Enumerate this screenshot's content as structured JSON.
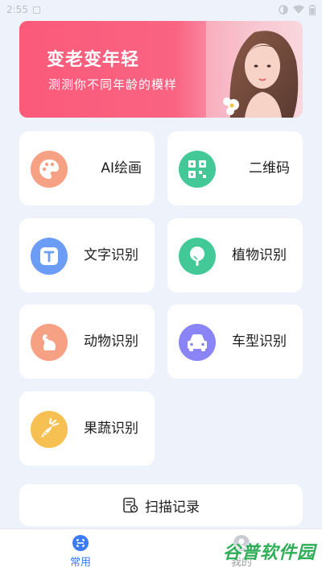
{
  "status_bar": {
    "time": "2:55"
  },
  "banner": {
    "title": "变老变年轻",
    "subtitle": "测测你不同年龄的模样"
  },
  "features": [
    {
      "label": "AI绘画",
      "icon": "palette-icon",
      "color": "#f7a184"
    },
    {
      "label": "二维码",
      "icon": "qrcode-icon",
      "color": "#43c998"
    },
    {
      "label": "文字识别",
      "icon": "text-recognition-icon",
      "color": "#6b9cf6"
    },
    {
      "label": "植物识别",
      "icon": "tree-icon",
      "color": "#43c998"
    },
    {
      "label": "动物识别",
      "icon": "animal-icon",
      "color": "#f7a184"
    },
    {
      "label": "车型识别",
      "icon": "car-icon",
      "color": "#8b84f6"
    },
    {
      "label": "果蔬识别",
      "icon": "carrot-icon",
      "color": "#f6c052"
    }
  ],
  "scan_record": {
    "label": "扫描记录",
    "icon": "scan-record-icon"
  },
  "bottom_nav": {
    "items": [
      {
        "label": "常用",
        "active": true
      },
      {
        "label": "我的",
        "active": false
      }
    ],
    "accent": "#3b7cf5"
  },
  "watermark": {
    "text": "谷普软件园"
  }
}
